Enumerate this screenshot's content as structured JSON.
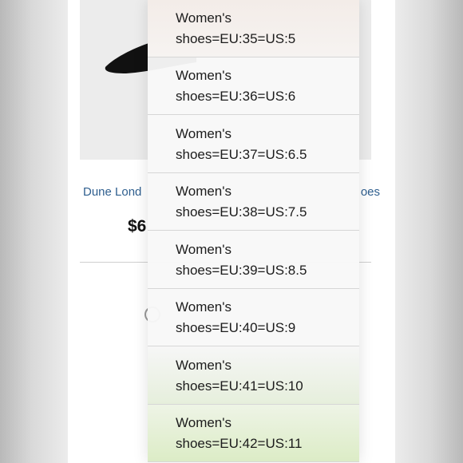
{
  "product": {
    "title_left": "Dune Lond",
    "title_right": "oes",
    "price_fragment": "$6"
  },
  "size_options": [
    {
      "label": "Women's shoes=EU:35=US:5"
    },
    {
      "label": "Women's shoes=EU:36=US:6"
    },
    {
      "label": "Women's shoes=EU:37=US:6.5"
    },
    {
      "label": "Women's shoes=EU:38=US:7.5"
    },
    {
      "label": "Women's shoes=EU:39=US:8.5"
    },
    {
      "label": "Women's shoes=EU:40=US:9"
    },
    {
      "label": "Women's shoes=EU:41=US:10"
    },
    {
      "label": "Women's shoes=EU:42=US:11"
    }
  ],
  "colors": {
    "link": "#2f5f8f",
    "selected_option": "#dcecc6"
  },
  "icons": {
    "product_image": "black-pointed-shoe"
  }
}
